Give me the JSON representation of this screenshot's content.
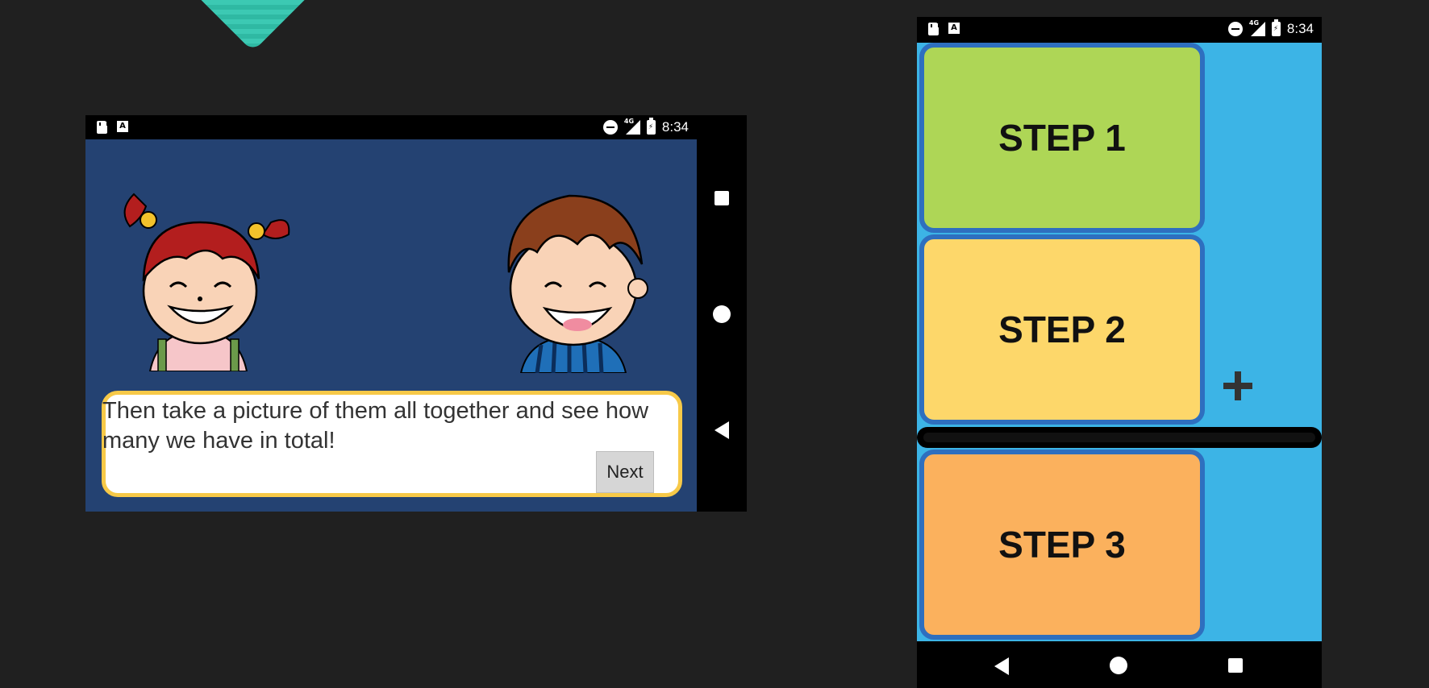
{
  "status_bar": {
    "time": "8:34",
    "network": "4G"
  },
  "lesson": {
    "message": "Then take a picture of them all together and see how many we have in total!",
    "next_label": "Next"
  },
  "steps": [
    {
      "label": "STEP 1",
      "color": "#aed656"
    },
    {
      "label": "STEP 2",
      "color": "#fdd76a"
    },
    {
      "label": "STEP 3",
      "color": "#fbb15d"
    }
  ],
  "colors": {
    "lesson_background": "#244272",
    "textbox_border": "#f7c948",
    "step_border": "#2e6fbf",
    "step_screen_background": "#3cb4e6"
  }
}
